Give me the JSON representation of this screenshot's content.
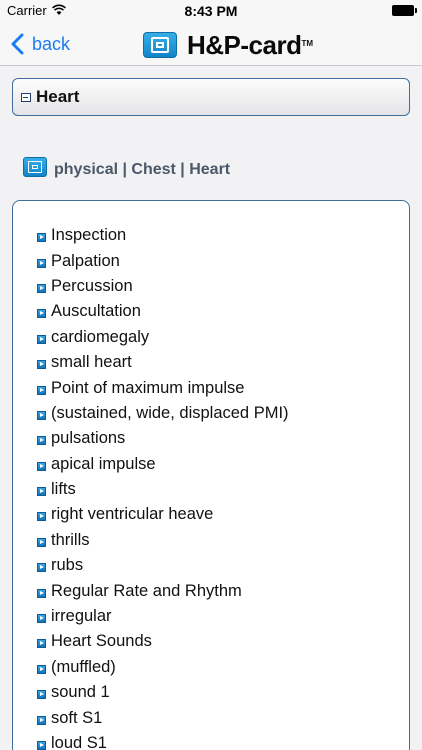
{
  "status_bar": {
    "carrier": "Carrier",
    "time": "8:43 PM",
    "wifi_icon": "wifi-icon",
    "battery_icon": "battery-icon"
  },
  "nav": {
    "back_label": "back",
    "logo_text": "H&P-card",
    "logo_tm": "TM",
    "accent_color": "#1a7cf5"
  },
  "section": {
    "title": "Heart"
  },
  "breadcrumb": {
    "text": "physical | Chest | Heart"
  },
  "items": [
    "Inspection",
    "Palpation",
    "Percussion",
    "Auscultation",
    "cardiomegaly",
    "small heart",
    "Point of maximum impulse",
    "(sustained, wide, displaced PMI)",
    "pulsations",
    "apical impulse",
    "lifts",
    "right ventricular heave",
    "thrills",
    "rubs",
    "Regular Rate and Rhythm",
    "irregular",
    "Heart Sounds",
    "(muffled)",
    "sound 1",
    "soft S1",
    "loud S1"
  ]
}
